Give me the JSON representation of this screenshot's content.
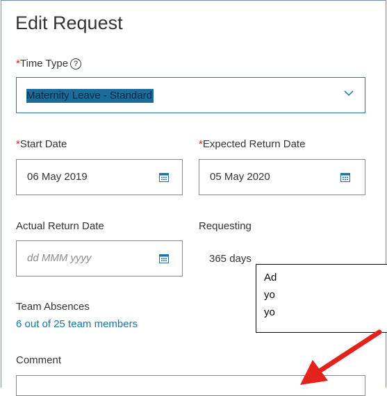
{
  "dialog": {
    "title": "Edit Request",
    "time_type": {
      "required_marker": "*",
      "label": "Time Type",
      "help_glyph": "?",
      "selected_value": "Maternity Leave - Standard"
    },
    "start_date": {
      "required_marker": "*",
      "label": "Start Date",
      "value": "06 May 2019"
    },
    "expected_return_date": {
      "required_marker": "*",
      "label": "Expected Return Date",
      "value": "05 May 2020"
    },
    "actual_return_date": {
      "label": "Actual Return Date",
      "placeholder": "dd MMM yyyy"
    },
    "requesting": {
      "label": "Requesting",
      "value": "365 days"
    },
    "team_absences": {
      "label": "Team Absences",
      "link": "6 out of 25 team members"
    },
    "comment": {
      "label": "Comment"
    }
  },
  "callout": {
    "lines": [
      "Ad",
      "yo",
      "yo"
    ]
  },
  "colors": {
    "required": "#d0271d",
    "accent": "#1a73a8",
    "selection_highlight": "#1a6d9b",
    "arrow": "#e3231b"
  }
}
